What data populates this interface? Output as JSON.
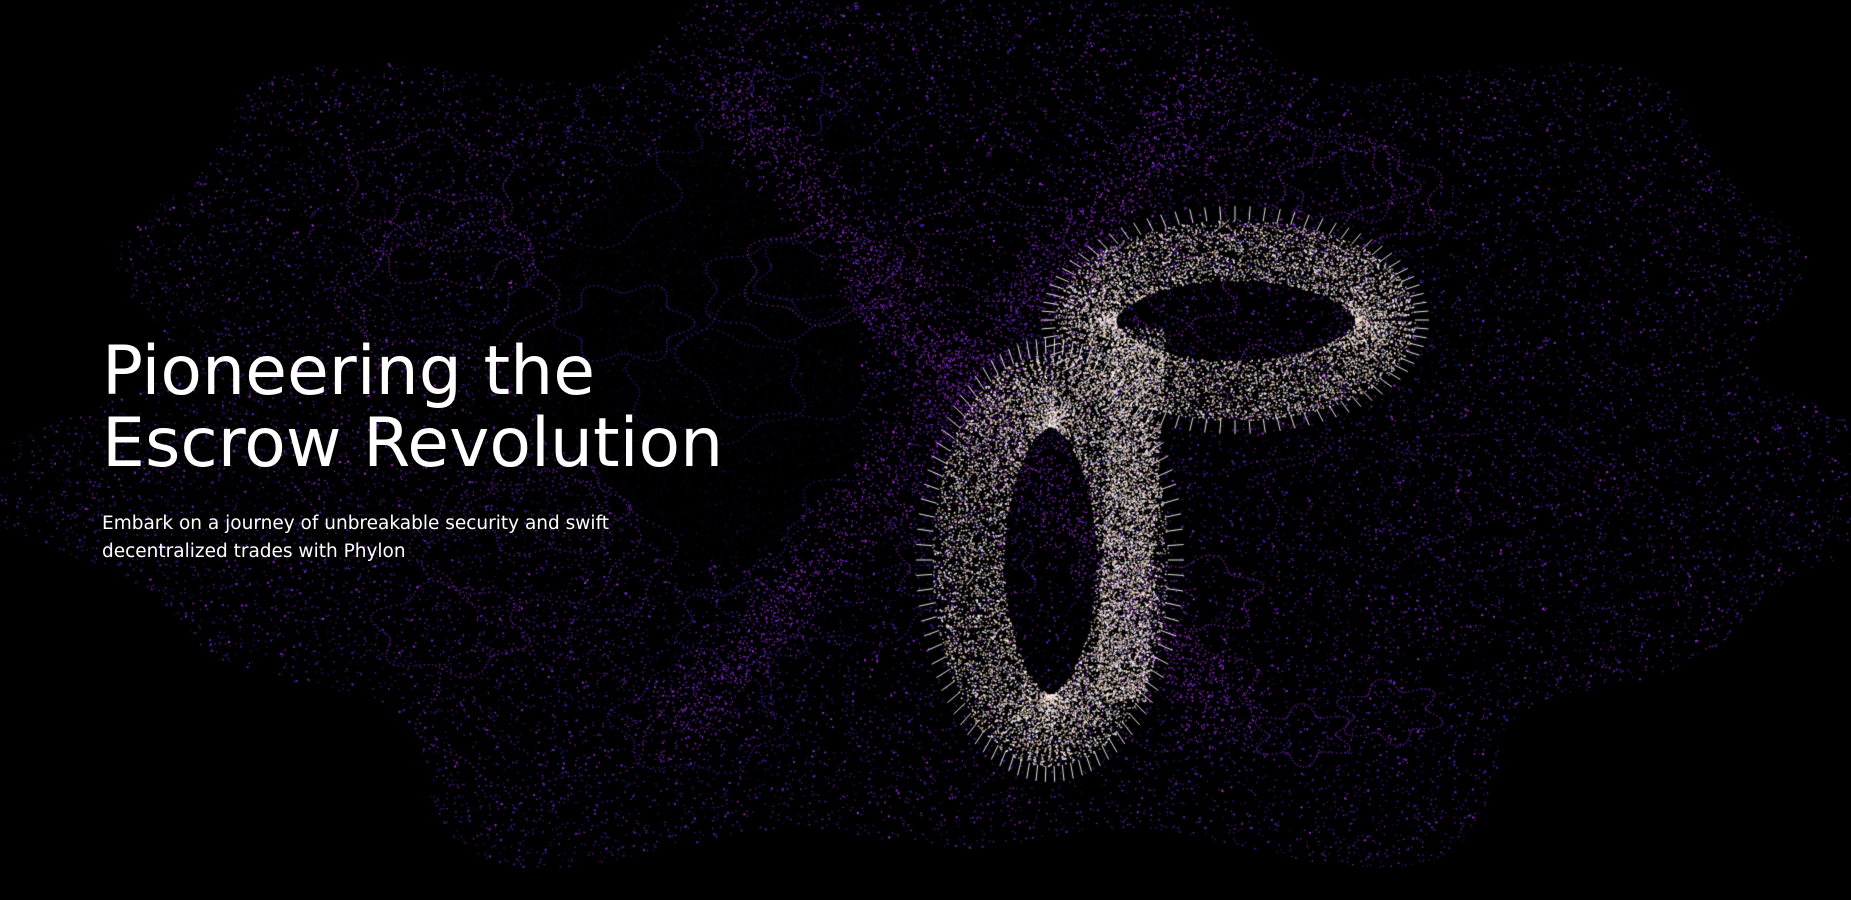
{
  "hero": {
    "title_line_1": "Pioneering the",
    "title_line_2": "Escrow Revolution",
    "subtitle": "Embark on a journey of unbreakable security and swift decentralized trades with Phylon"
  },
  "background": {
    "base_color": "#000000",
    "particle_colors": [
      "#9b30ff",
      "#6a2cff",
      "#c23cff",
      "#4a2bdc"
    ],
    "logo_particle_colors": [
      "#ffffff",
      "#f3e9ff",
      "#ffd8b0"
    ]
  },
  "logo": {
    "icon": "phylon-logo-icon"
  }
}
